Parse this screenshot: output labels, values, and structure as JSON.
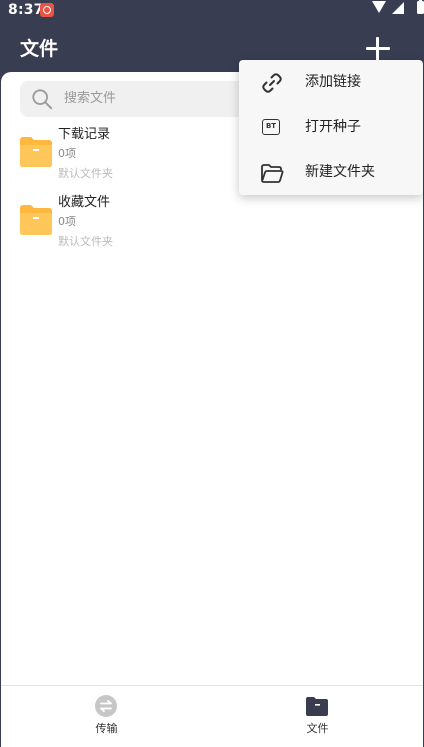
{
  "status_bar": {
    "time": "8:37"
  },
  "header": {
    "title": "文件"
  },
  "search": {
    "placeholder": "搜索文件"
  },
  "folders": [
    {
      "name": "下载记录",
      "count": "0项",
      "type": "默认文件夹"
    },
    {
      "name": "收藏文件",
      "count": "0项",
      "type": "默认文件夹"
    }
  ],
  "menu": {
    "items": [
      {
        "label": "添加链接",
        "icon": "link-icon"
      },
      {
        "label": "打开种子",
        "icon": "bt-torrent-icon",
        "badge": "BT"
      },
      {
        "label": "新建文件夹",
        "icon": "folder-open-icon"
      }
    ]
  },
  "bottom_nav": {
    "items": [
      {
        "label": "传输",
        "icon": "transfer-icon"
      },
      {
        "label": "文件",
        "icon": "folder-icon",
        "active": true
      }
    ]
  },
  "colors": {
    "header_bg": "#393d52",
    "folder": "#ffb83f",
    "accent_dark": "#3a3d50"
  }
}
